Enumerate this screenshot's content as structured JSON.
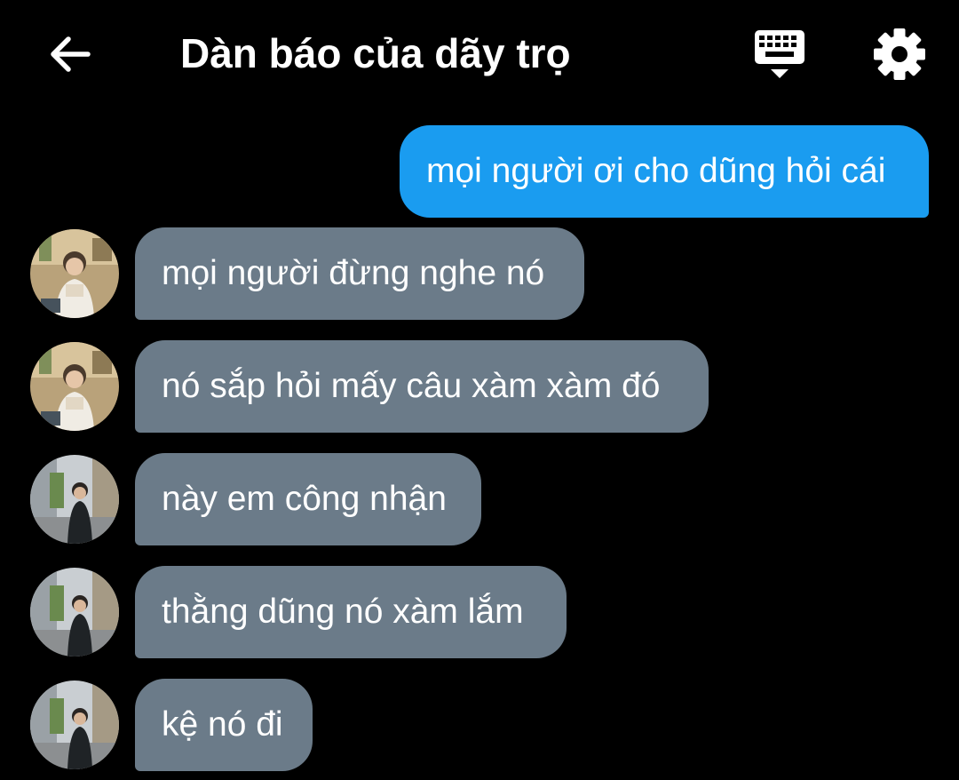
{
  "header": {
    "title": "Dàn báo của dãy trọ",
    "back_icon": "arrow-left-icon",
    "keyboard_icon": "keyboard-icon",
    "settings_icon": "gear-icon"
  },
  "colors": {
    "background": "#000000",
    "outgoing_bubble": "#1a9cf0",
    "incoming_bubble": "#6b7b89",
    "text": "#ffffff"
  },
  "messages": [
    {
      "direction": "outgoing",
      "text": "mọi người ơi cho dũng hỏi cái"
    },
    {
      "direction": "incoming",
      "sender_avatar": "avatar-a",
      "text": "mọi người đừng nghe nó"
    },
    {
      "direction": "incoming",
      "sender_avatar": "avatar-a",
      "text": "nó sắp hỏi mấy câu xàm xàm đó"
    },
    {
      "direction": "incoming",
      "sender_avatar": "avatar-b",
      "text": "này em công nhận"
    },
    {
      "direction": "incoming",
      "sender_avatar": "avatar-b",
      "text": "thằng dũng nó xàm lắm"
    },
    {
      "direction": "incoming",
      "sender_avatar": "avatar-b",
      "text": "kệ nó đi"
    }
  ]
}
